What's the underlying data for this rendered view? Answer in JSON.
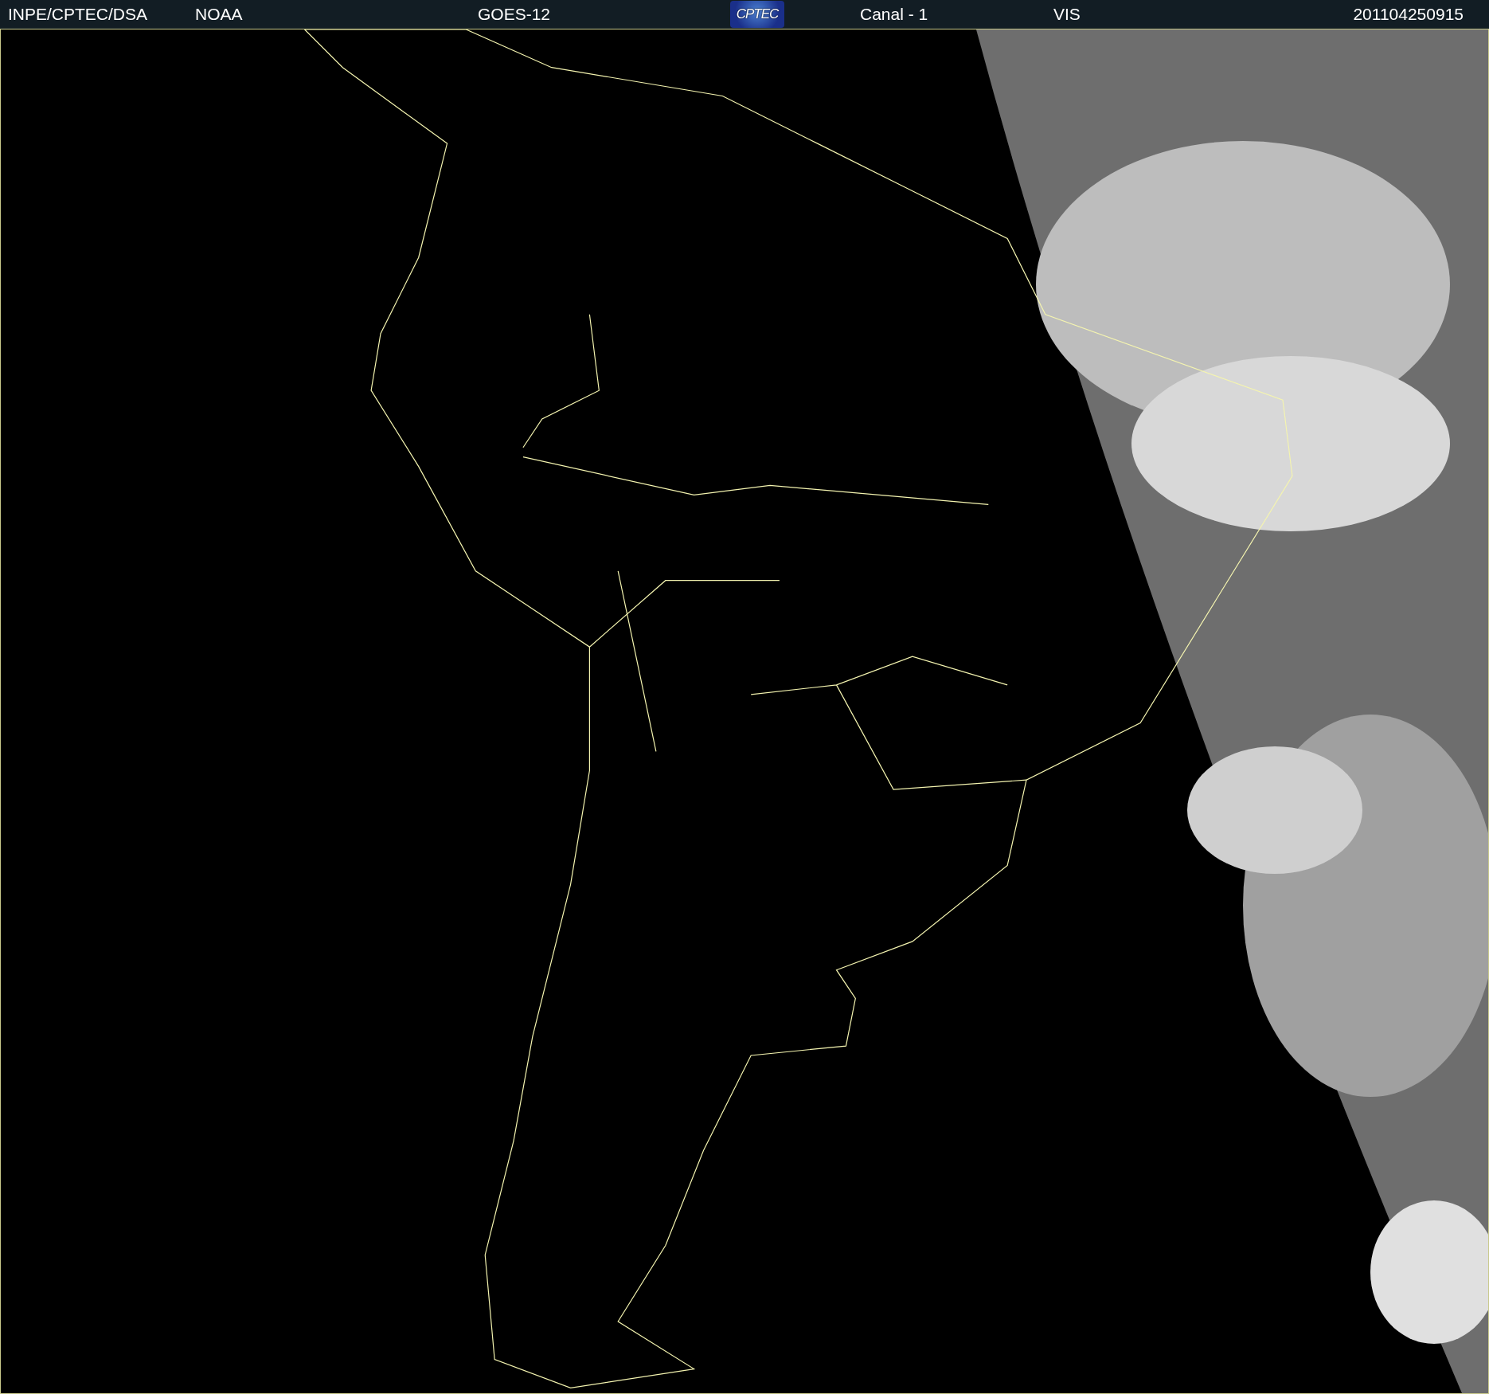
{
  "header": {
    "source": "INPE/CPTEC/DSA",
    "agency": "NOAA",
    "satellite": "GOES-12",
    "logo": "CPTEC",
    "channel": "Canal - 1",
    "band": "VIS",
    "timestamp": "201104250915"
  }
}
